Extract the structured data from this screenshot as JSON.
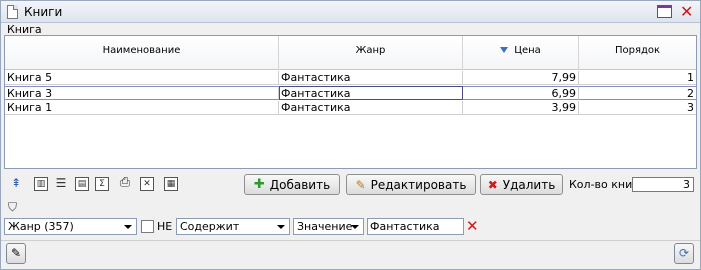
{
  "window": {
    "title": "Книги"
  },
  "group": {
    "label": "Книга"
  },
  "grid": {
    "columns": [
      "Наименование",
      "Жанр",
      "Цена",
      "Порядок"
    ],
    "sort_column": "Цена",
    "rows": [
      {
        "name": "Книга 5",
        "genre": "Фантастика",
        "price": "7,99",
        "order": "1"
      },
      {
        "name": "Книга 3",
        "genre": "Фантастика",
        "price": "6,99",
        "order": "2"
      },
      {
        "name": "Книга 1",
        "genre": "Фантастика",
        "price": "3,99",
        "order": "3"
      }
    ]
  },
  "toolbar": {
    "add_label": "Добавить",
    "edit_label": "Редактировать",
    "delete_label": "Удалить",
    "count_label": "Кол-во книг",
    "count_value": "3"
  },
  "filter": {
    "field_select": "Жанр (357)",
    "not_label": "НЕ",
    "operator_select": "Содержит",
    "value_type_select": "Значение",
    "value": "Фантастика"
  },
  "colors": {
    "accent": "#3a6fc4",
    "close": "#d01818",
    "add": "#2a9a2a"
  }
}
